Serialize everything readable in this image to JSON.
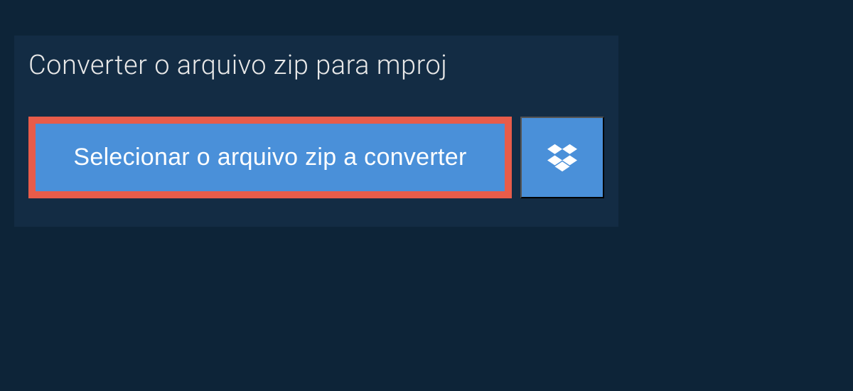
{
  "header": {
    "title": "Converter o arquivo zip para mproj"
  },
  "actions": {
    "select_file_label": "Selecionar o arquivo zip a converter"
  },
  "colors": {
    "background": "#0d2438",
    "panel": "#132c44",
    "button": "#4a90d9",
    "highlight_border": "#e85c4a",
    "text_light": "#e8e8e8",
    "text_white": "#ffffff"
  },
  "icons": {
    "dropbox": "dropbox-icon"
  }
}
